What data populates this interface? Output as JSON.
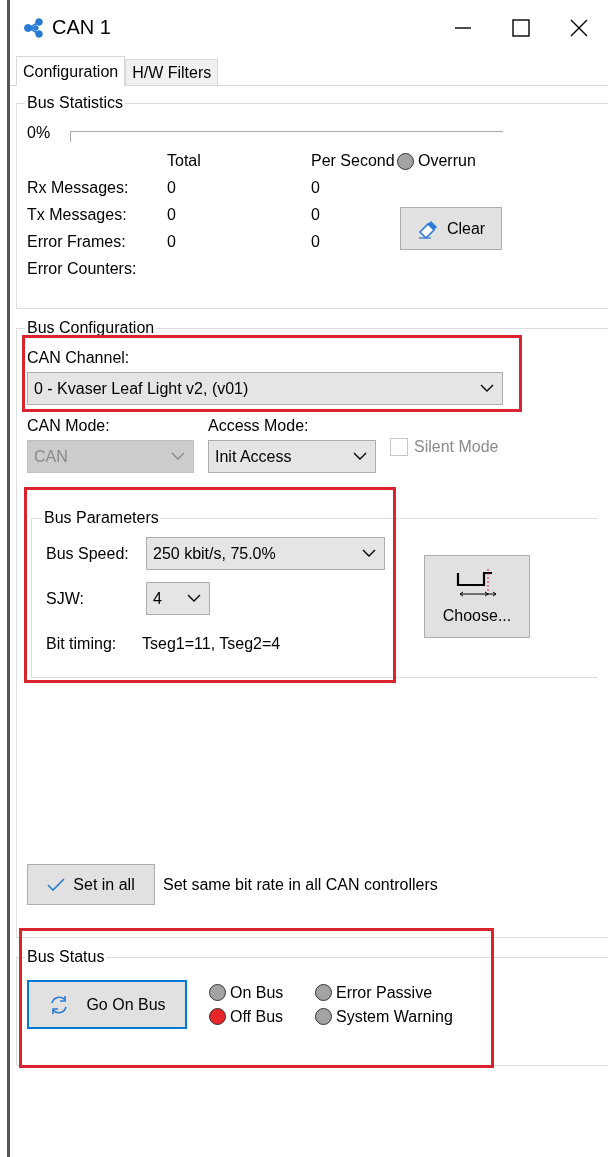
{
  "window": {
    "title": "CAN 1"
  },
  "tabs": [
    {
      "label": "Configuration",
      "selected": true
    },
    {
      "label": "H/W Filters",
      "selected": false
    }
  ],
  "bus_statistics": {
    "title": "Bus Statistics",
    "load": {
      "reading": "0%",
      "level": 0
    },
    "columns": [
      "Total",
      "Per Second"
    ],
    "overrun": {
      "label": "Overrun",
      "color": "#a3a3a3"
    },
    "rows": [
      {
        "label": "Rx Messages:",
        "total": "0",
        "per_second": "0"
      },
      {
        "label": "Tx Messages:",
        "total": "0",
        "per_second": "0"
      },
      {
        "label": "Error Frames:",
        "total": "0",
        "per_second": "0"
      }
    ],
    "error_counters": "Error Counters:",
    "clear_button": "Clear"
  },
  "bus_configuration": {
    "title": "Bus Configuration",
    "can_channel": {
      "label": "CAN Channel:",
      "value": "0 - Kvaser Leaf Light v2, (v01)",
      "highlighted": true
    },
    "can_mode": {
      "label": "CAN Mode:",
      "value": "CAN",
      "disabled": true
    },
    "access_mode": {
      "label": "Access Mode:",
      "value": "Init Access",
      "disabled": false
    },
    "silent_mode": {
      "label": "Silent Mode",
      "checked": false,
      "disabled": true
    },
    "bus_parameters": {
      "title": "Bus Parameters",
      "highlighted": true,
      "bus_speed": {
        "label": "Bus Speed:",
        "value": "250 kbit/s, 75.0%"
      },
      "sjw": {
        "label": "SJW:",
        "value": "4"
      },
      "bit_timing": {
        "label": "Bit timing:",
        "value": "Tseg1=11, Tseg2=4"
      },
      "choose_button": "Choose..."
    },
    "set_in_all": {
      "button": "Set in all",
      "description": "Set same bit rate in all CAN controllers"
    }
  },
  "bus_status": {
    "title": "Bus Status",
    "highlighted": true,
    "button": {
      "label": "Go On Bus",
      "focused": true
    },
    "indicators": [
      {
        "label": "On Bus",
        "color": "#a3a3a3"
      },
      {
        "label": "Error Passive",
        "color": "#a3a3a3"
      },
      {
        "label": "Off Bus",
        "color": "#e8262a"
      },
      {
        "label": "System Warning",
        "color": "#a3a3a3"
      }
    ]
  }
}
